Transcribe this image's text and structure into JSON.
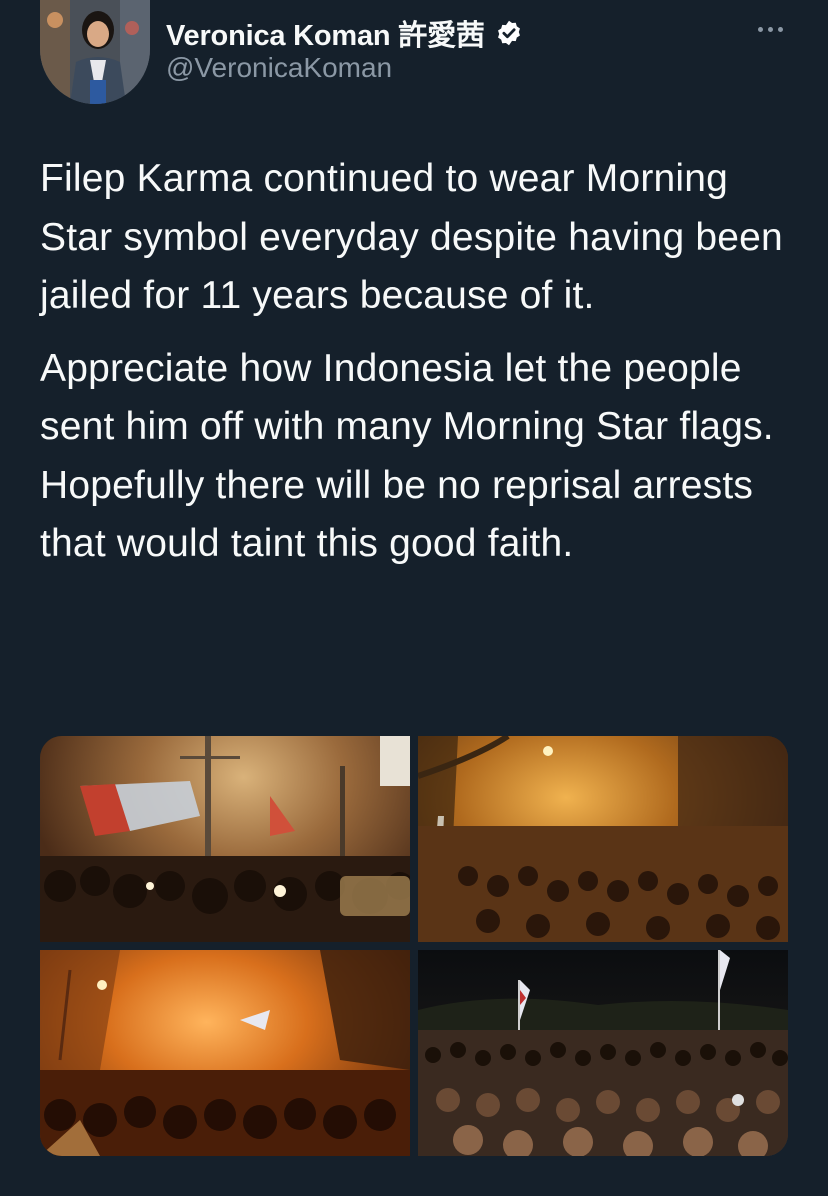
{
  "author": {
    "display_name": "Veronica Koman 許愛茜",
    "handle": "@VeronicaKoman",
    "verified": true,
    "avatar_icon": "profile-photo"
  },
  "menu": {
    "more_icon": "more-horizontal-icon"
  },
  "tweet": {
    "paragraphs": [
      "Filep Karma continued to wear Morning Star symbol everyday despite having been jailed for 11 years because of it.",
      "Appreciate how Indonesia let the people sent him off with many Morning Star flags. Hopefully there will be no reprisal arrests that would taint this good faith."
    ]
  },
  "media": {
    "photos": [
      {
        "subject": "crowd with flags at night, street lights"
      },
      {
        "subject": "large crowd on road at night, orange lights"
      },
      {
        "subject": "crowd in smoky orange light"
      },
      {
        "subject": "seated crowd at night with flags"
      }
    ]
  },
  "colors": {
    "background": "#15202b",
    "text_primary": "#f7f9f9",
    "text_secondary": "#8b98a5",
    "verified_badge": "#ffffff"
  }
}
